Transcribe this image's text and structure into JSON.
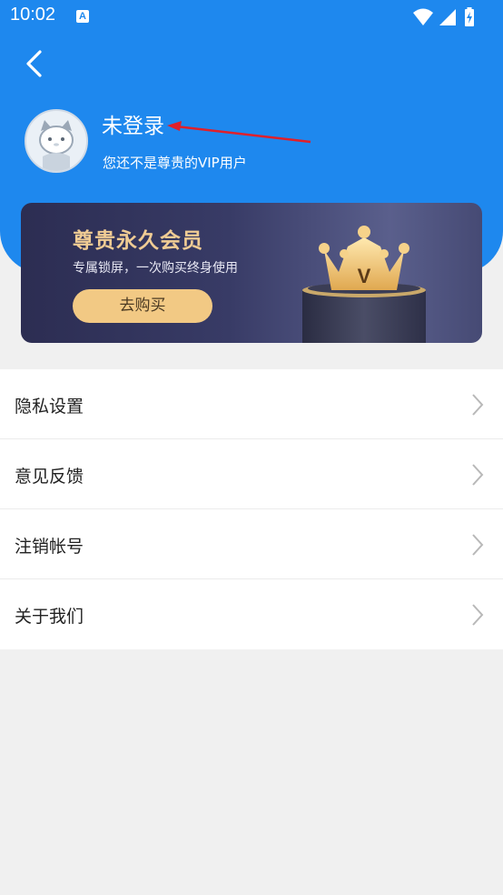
{
  "status_bar": {
    "time": "10:02",
    "notification_icon": "A",
    "icons": [
      "wifi-icon",
      "signal-icon",
      "battery-icon"
    ]
  },
  "header": {
    "back_icon": "back-arrow-icon",
    "avatar_icon": "cat-avatar-icon",
    "username": "未登录",
    "subtitle": "您还不是尊贵的VIP用户"
  },
  "vip_card": {
    "title": "尊贵永久会员",
    "subtitle": "专属锁屏，一次购买终身使用",
    "button_label": "去购买",
    "badge_letter": "V"
  },
  "menu": {
    "items": [
      {
        "label": "隐私设置"
      },
      {
        "label": "意见反馈"
      },
      {
        "label": "注销帐号"
      },
      {
        "label": "关于我们"
      }
    ]
  },
  "colors": {
    "primary": "#1e88ee",
    "card_gold": "#f0cc94",
    "button_gold": "#f2c984",
    "annotation_red": "#e0202a"
  }
}
